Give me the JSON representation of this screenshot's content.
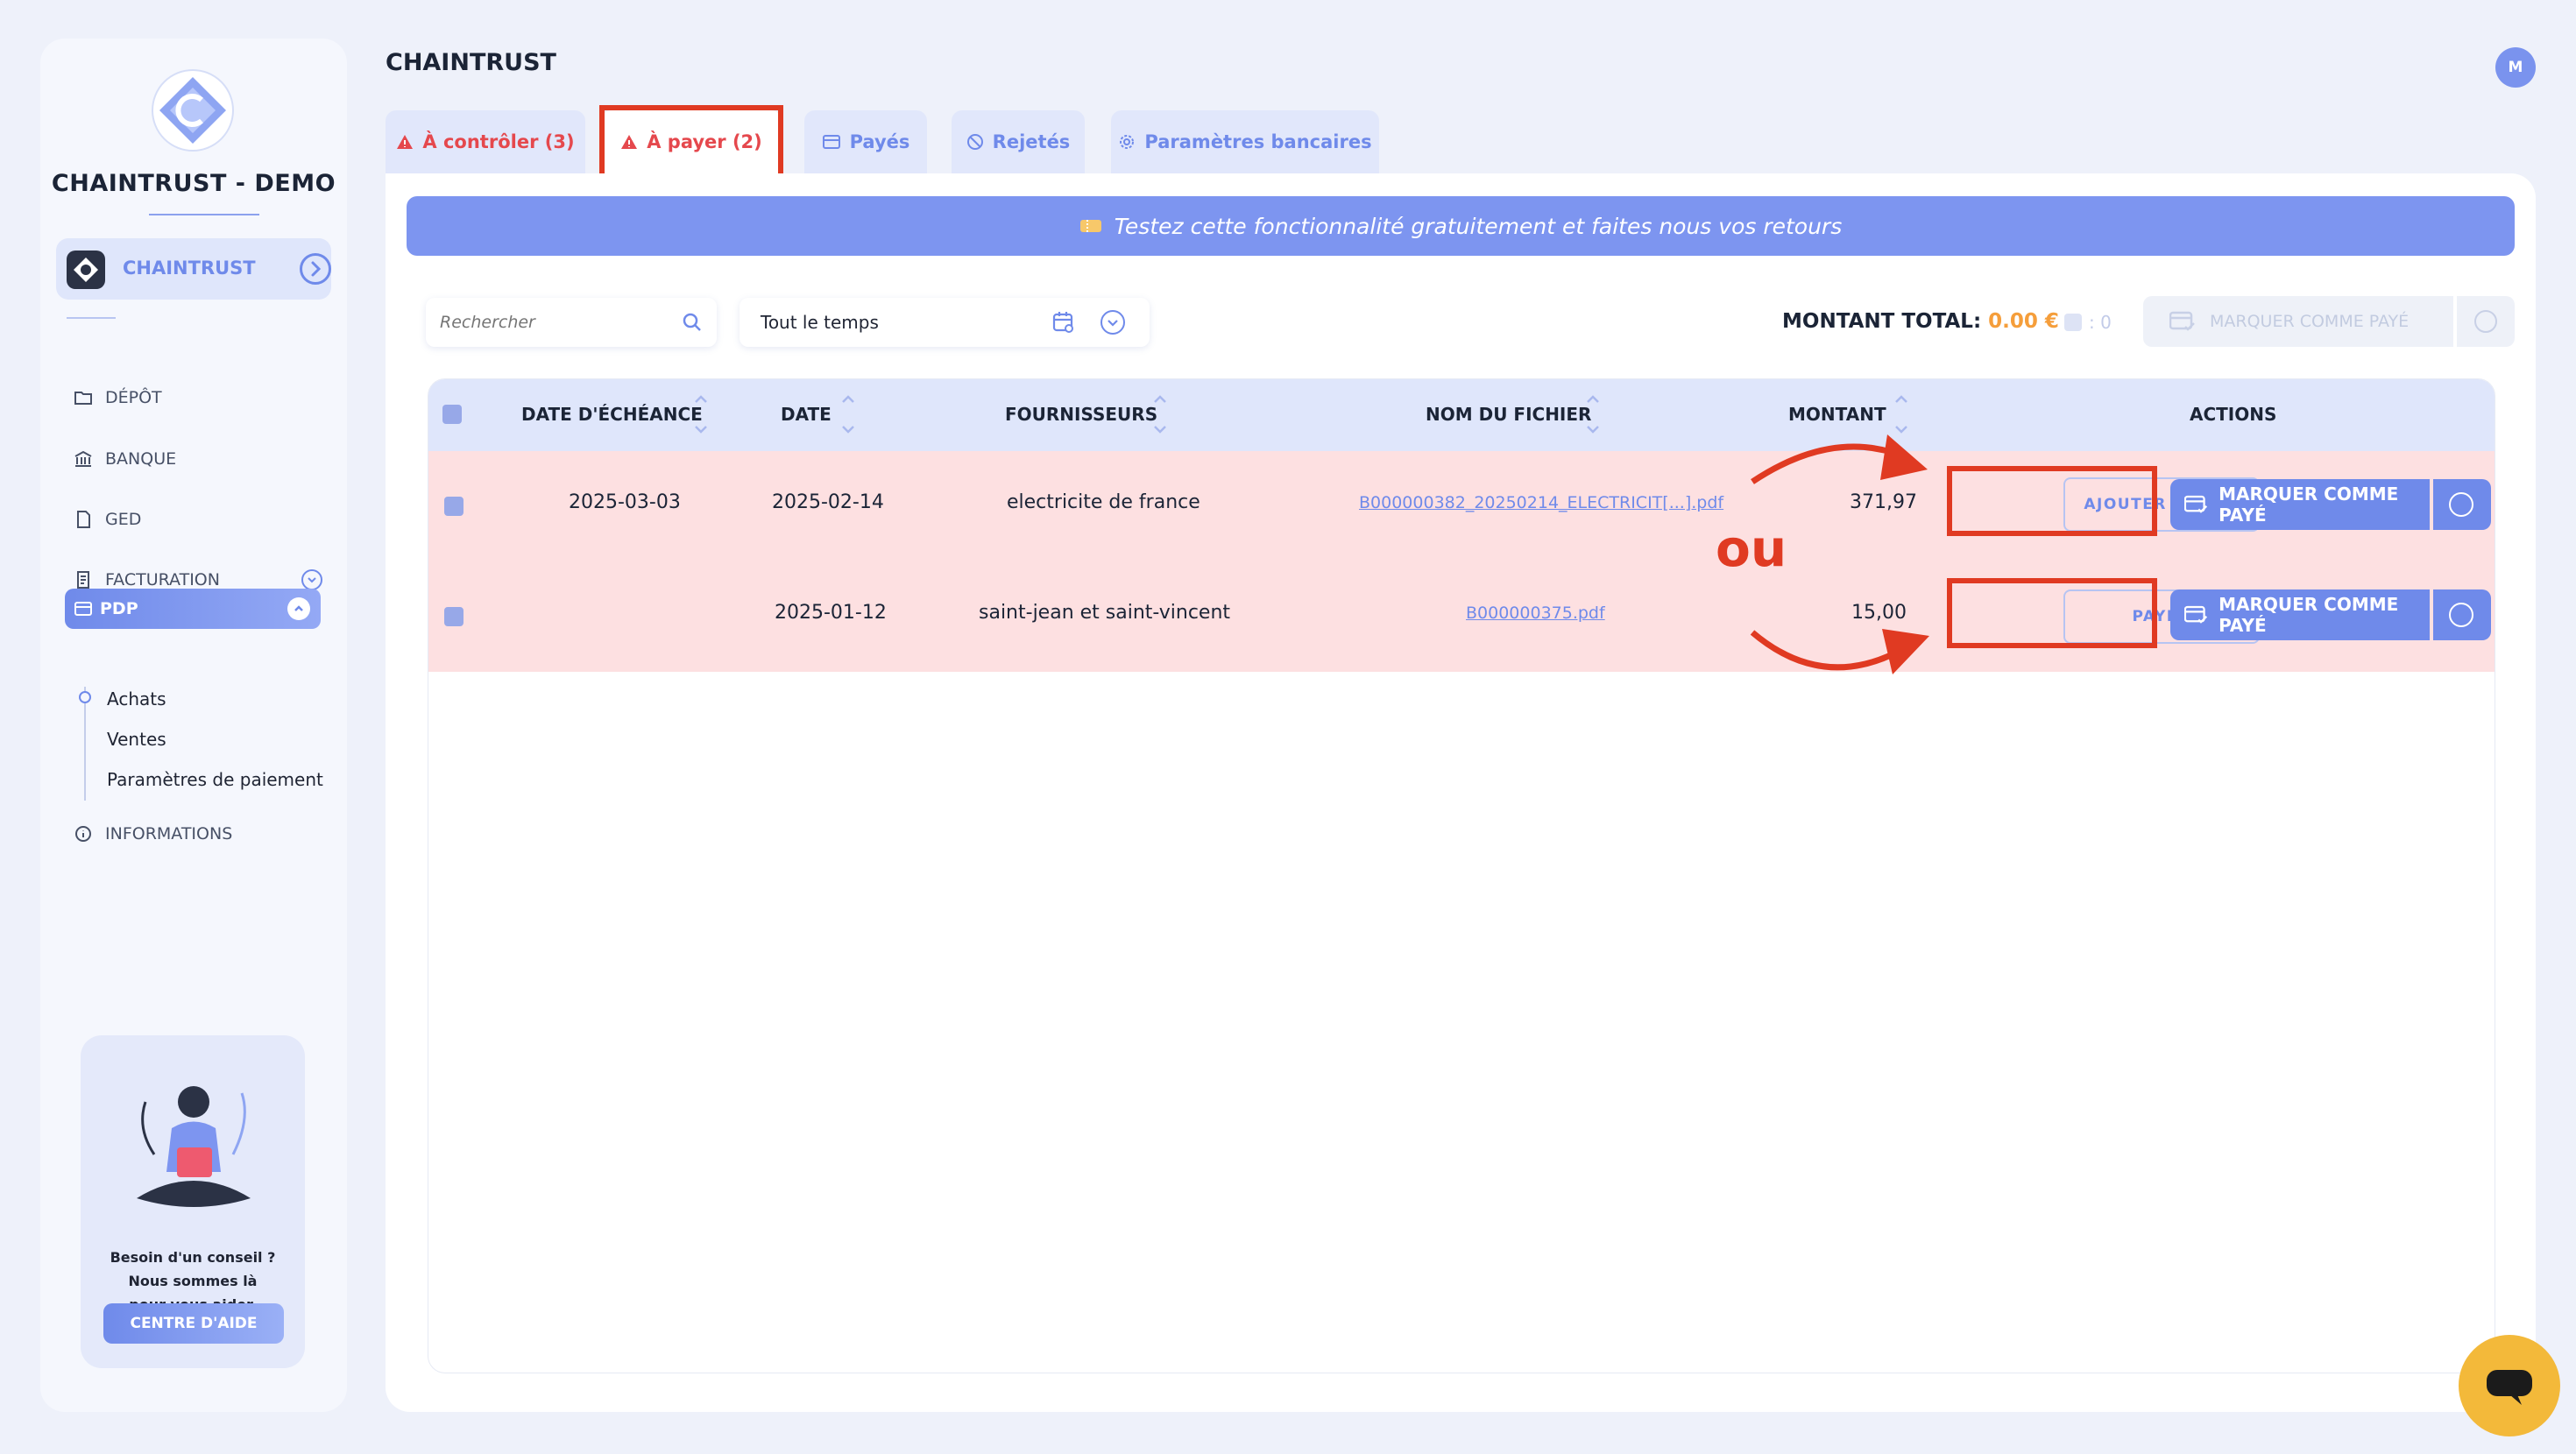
{
  "sidebar": {
    "brand": "CHAINTRUST - DEMO",
    "org": "CHAINTRUST",
    "nav": {
      "depot": "DÉPÔT",
      "banque": "BANQUE",
      "ged": "GED",
      "facturation": "FACTURATION",
      "pdp": "PDP",
      "informations": "INFORMATIONS"
    },
    "pdp_sub": [
      "Achats",
      "Ventes",
      "Paramètres de paiement"
    ],
    "help": {
      "line1": "Besoin d'un conseil ?",
      "line2": "Nous sommes là",
      "line3": "pour vous aider.",
      "button": "CENTRE D'AIDE"
    }
  },
  "header": {
    "title": "CHAINTRUST",
    "avatar_initial": "M"
  },
  "tabs": [
    {
      "label": "À contrôler (3)"
    },
    {
      "label": "À payer (2)"
    },
    {
      "label": "Payés"
    },
    {
      "label": "Rejetés"
    },
    {
      "label": "Paramètres bancaires"
    }
  ],
  "banner": "Testez cette fonctionnalité gratuitement et faites nous vos retours",
  "filters": {
    "search_placeholder": "Rechercher",
    "period": "Tout le temps"
  },
  "summary": {
    "total_label": "MONTANT TOTAL:",
    "total_value": "0.00 €",
    "selected_count": ": 0",
    "mark_all": "MARQUER COMME PAYÉ"
  },
  "table": {
    "columns": [
      "DATE D'ÉCHÉANCE",
      "DATE",
      "FOURNISSEURS",
      "NOM DU FICHIER",
      "MONTANT",
      "ACTIONS"
    ],
    "rows": [
      {
        "due_date": "2025-03-03",
        "date": "2025-02-14",
        "supplier": "electricite de france",
        "file": "B000000382_20250214_ELECTRICIT[...].pdf",
        "amount": "371,97",
        "action": "AJOUTER UN RIB",
        "mark": "MARQUER COMME PAYÉ"
      },
      {
        "due_date": "",
        "date": "2025-01-12",
        "supplier": "saint-jean et saint-vincent",
        "file": "B000000375.pdf",
        "amount": "15,00",
        "action": "PAYER",
        "mark": "MARQUER COMME PAYÉ"
      }
    ]
  },
  "annotation": {
    "ou": "ou",
    "color": "#e03a22"
  },
  "colors": {
    "accent": "#6f8aea",
    "warning": "#e5484d",
    "amount": "#f59e3b",
    "row_bg": "#fde0e1"
  }
}
